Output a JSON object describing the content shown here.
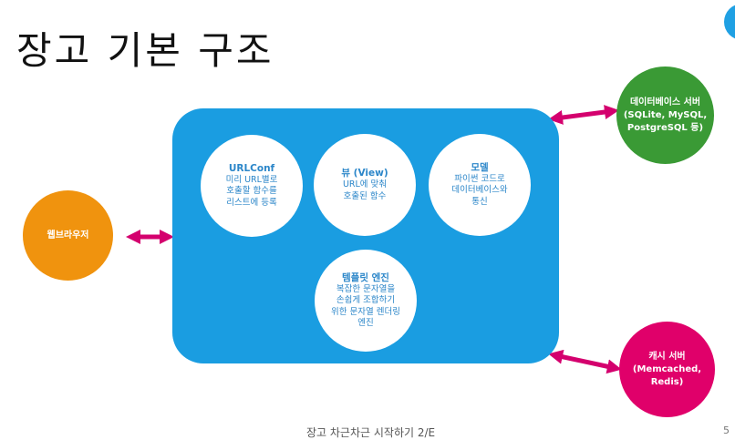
{
  "title": "장고 기본 구조",
  "center": {
    "urlconf": {
      "title": "URLConf",
      "desc": "미리 URL별로\n호출할 함수를\n리스트에 등록"
    },
    "view": {
      "title": "뷰 (View)",
      "desc": "URL에 맞춰\n호출된 함수"
    },
    "model": {
      "title": "모델",
      "desc": "파이썬 코드로\n데이터베이스와\n통신"
    },
    "template": {
      "title": "템플릿 엔진",
      "desc": "복잡한 문자열을\n손쉽게 조합하기\n위한 문자열 렌더링\n엔진"
    }
  },
  "browser": {
    "label": "웹브라우저"
  },
  "database": {
    "label": "데이터베이스 서버\n(SQLite, MySQL,\nPostgreSQL 등)"
  },
  "cache": {
    "label": "캐시 서버\n(Memcached, Redis)"
  },
  "footer": {
    "text": "장고 차근차근 시작하기 2/E",
    "page": "5"
  },
  "colors": {
    "panel": "#1a9de1",
    "browser": "#f0930e",
    "database": "#3a9a35",
    "cache": "#e0006a",
    "arrow": "#d4006e"
  }
}
